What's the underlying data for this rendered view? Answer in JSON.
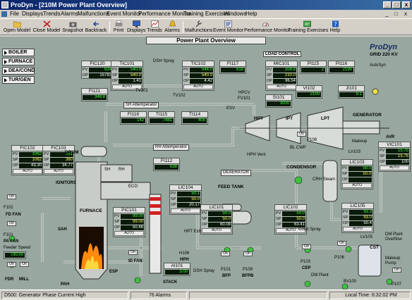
{
  "window": {
    "title": "ProDyn - [210M Power Plant Overview]",
    "buttons": [
      "_",
      "□",
      "x"
    ]
  },
  "menu": [
    "File",
    "Displays",
    "Trends",
    "Alarms",
    "Malfunctions",
    "Event Monitor",
    "Performance Monitor",
    "Training Exercises",
    "Windows",
    "Help"
  ],
  "menu_right_buttons": [
    "_",
    "□",
    "x"
  ],
  "toolbar": [
    "Open Model",
    "Close Model",
    "Snapshot",
    "Backtrack",
    "Print",
    "Displays",
    "Trends",
    "Alarms",
    "Malfunctions",
    "Event Monitor",
    "Performance Monitor",
    "Training Exercises",
    "Help"
  ],
  "page_title": "Power Plant Overview",
  "nav_buttons": [
    "BOILER",
    "FURNACE",
    "DEA/COND",
    "TUR/GEN"
  ],
  "brand": {
    "logo": "ProDyn",
    "grid": "GRID 220 KV",
    "autosyn": "AutoSyn"
  },
  "controllers": {
    "FIC120": {
      "tag": "FIC120",
      "pv": "634",
      "sp": "",
      "out": "15783"
    },
    "TIC101": {
      "tag": "TIC101",
      "pv": "540.9",
      "sp": "540.0",
      "out": "1.41",
      "mode": "AUTO"
    },
    "TIC102": {
      "tag": "TIC102",
      "pv": "544.0",
      "sp": "540.0",
      "out": "4.42",
      "mode": "AUTO"
    },
    "MIC101": {
      "tag": "MIC101",
      "pv": "209.8",
      "sp": "210.0",
      "out": "96.54",
      "mode": "AUTO"
    },
    "FIC102": {
      "tag": "FIC102",
      "pv": "1062",
      "sp": "1062",
      "out": "43.30",
      "mode": "AUTO"
    },
    "FIC103": {
      "tag": "FIC103",
      "pv": "361",
      "sp": "360",
      "out": "34.77",
      "mode": "AUTO"
    },
    "PIC101": {
      "tag": "PIC101",
      "pv": "99.00",
      "sp": "99.00",
      "out": "50.46",
      "mode": "AUTO"
    },
    "LIC104": {
      "tag": "LIC104",
      "pv": "50.1",
      "sp": "50.0",
      "out": "20.17",
      "mode": "AUTO"
    },
    "LIC101": {
      "tag": "LIC101",
      "pv": "50.0",
      "sp": "50.0",
      "out": "60.08",
      "mode": "AUTO"
    },
    "LIC102": {
      "tag": "LIC102",
      "pv": "50.0",
      "sp": "50.0",
      "out": "63.41",
      "mode": "AUTO"
    },
    "LIC103": {
      "tag": "LIC103",
      "pv": "50.0",
      "sp": "50.0",
      "out": "",
      "mode": "AUTO"
    },
    "LIC105": {
      "tag": "LIC105",
      "pv": "93.3",
      "sp": "93.0",
      "out": "50.4",
      "mode": "AUTO"
    },
    "VIC101": {
      "tag": "VIC101",
      "pv": "15.75",
      "sp": "15.75",
      "out": "100",
      "mode": "AUTO"
    }
  },
  "indicators": {
    "FI121": {
      "tag": "FI121",
      "value": "348.8"
    },
    "FI117": {
      "tag": "FI117",
      "value": "618"
    },
    "PI115": {
      "tag": "PI115",
      "value": "2"
    },
    "PI116": {
      "tag": "PI116",
      "value": "2190"
    },
    "SI101": {
      "tag": "SI101",
      "value": "3000"
    },
    "VI102": {
      "tag": "VI102",
      "value": "2100"
    },
    "JI101": {
      "tag": "JI101",
      "value": "9.1"
    },
    "FI116": {
      "tag": "FI116",
      "value": "142"
    },
    "TI115": {
      "tag": "TI115",
      "value": "7481"
    },
    "TI114": {
      "tag": "TI114",
      "value": "405"
    },
    "FI112": {
      "tag": "FI112",
      "value": "638"
    },
    "AI101": {
      "tag": "AI101",
      "value": "3.00"
    }
  },
  "labels": {
    "load_control": "LOAD CONTROL",
    "dsh_spray": "DSH Spray",
    "sh_attemperator": "SH Attemperator",
    "rh_attemperator": "RH Attemperator",
    "drum": "DRUM",
    "sh": "SH",
    "rh": "RH",
    "eco": "ECO",
    "hph_vent": "HPH Vent",
    "ignitors": "IGNITORS",
    "furnace": "FURNACE",
    "deaerator": "DEAERATOR",
    "feed_tank": "FEED TANK",
    "condensor": "CONDENSOR",
    "crh_steam": "CRH Steam",
    "hpt": "HPT",
    "ipt": "IPT",
    "lpt": "LPT",
    "generator": "GENERATOR",
    "hpcv": "HPCV",
    "esv": "ESV",
    "tv101": "TV101",
    "tv102": "TV102",
    "fv101": "FV101",
    "bl_cwp": "BL CWP",
    "p108": "P108",
    "makeup": "Makeup",
    "lv103": "LV103",
    "avr": "AVR",
    "f102": "F102",
    "fd_fan": "FD FAN",
    "f101": "F101",
    "pa_fan": "PA FAN",
    "feeder_speed": "Feeder Speed",
    "feeder_value": "730.00",
    "fdr": "FDR",
    "mill": "MILL",
    "sah": "SAH",
    "pah": "PAH",
    "esp": "ESP",
    "id_fan": "ID FAN",
    "stack": "STACK",
    "hph_exit": "HPT Exit",
    "h106": "H106",
    "hph": "HPH",
    "dsh_spray2": "DSH Spray",
    "p101": "P101",
    "bfp": "BFP",
    "p109": "P109",
    "bfpb": "BFPB",
    "cond_spray": "Cond Spray",
    "p103": "P103",
    "cep": "CEP",
    "p106": "P106",
    "lv105": "LV105",
    "dm_plant_overflow": "DM Plant Overflow",
    "cst": "CST",
    "makeup_pump": "Makeup Pump",
    "dm_plant": "DM Plant",
    "bv100": "BV100",
    "p107": "P107",
    "on": "On"
  },
  "status": {
    "message": "D500: Generator Phase Current High",
    "alarms": "76 Alarms",
    "time": "Local Time: 6:32:02 PM"
  },
  "colors": {
    "canvas": "#98a8a0",
    "faceplate": "#b4bcb8",
    "value_green": "#40ff40",
    "titlebar": "#0a246a"
  }
}
